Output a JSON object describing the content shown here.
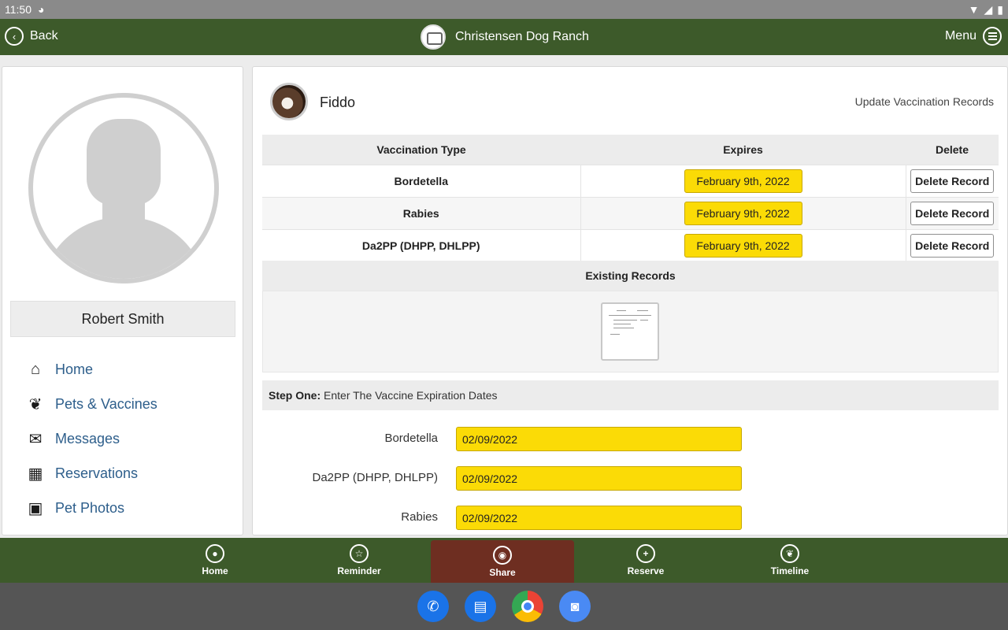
{
  "status_bar": {
    "time": "11:50"
  },
  "header": {
    "back_label": "Back",
    "title": "Christensen Dog Ranch",
    "menu_label": "Menu"
  },
  "sidebar": {
    "user_name": "Robert Smith",
    "items": [
      {
        "label": "Home",
        "icon": "home-icon"
      },
      {
        "label": "Pets & Vaccines",
        "icon": "paw-icon"
      },
      {
        "label": "Messages",
        "icon": "envelope-icon"
      },
      {
        "label": "Reservations",
        "icon": "calendar-icon"
      },
      {
        "label": "Pet Photos",
        "icon": "photos-icon"
      }
    ]
  },
  "pet": {
    "name": "Fiddo",
    "update_link": "Update Vaccination Records"
  },
  "vaccinations": {
    "columns": [
      "Vaccination Type",
      "Expires",
      "Delete"
    ],
    "rows": [
      {
        "type": "Bordetella",
        "expires": "February 9th, 2022",
        "delete_label": "Delete Record"
      },
      {
        "type": "Rabies",
        "expires": "February 9th, 2022",
        "delete_label": "Delete Record"
      },
      {
        "type": "Da2PP (DHPP, DHLPP)",
        "expires": "February 9th, 2022",
        "delete_label": "Delete Record"
      }
    ]
  },
  "existing_records": {
    "title": "Existing Records"
  },
  "step_one": {
    "prefix": "Step One:",
    "text": " Enter The Vaccine Expiration Dates"
  },
  "form": {
    "fields": [
      {
        "label": "Bordetella",
        "value": "02/09/2022"
      },
      {
        "label": "Da2PP (DHPP, DHLPP)",
        "value": "02/09/2022"
      },
      {
        "label": "Rabies",
        "value": "02/09/2022"
      }
    ]
  },
  "bottom_nav": {
    "items": [
      {
        "label": "Home",
        "icon": "person-icon"
      },
      {
        "label": "Reminder",
        "icon": "star-icon"
      },
      {
        "label": "Share",
        "icon": "camera-icon"
      },
      {
        "label": "Reserve",
        "icon": "plus-icon"
      },
      {
        "label": "Timeline",
        "icon": "paw-icon"
      }
    ]
  },
  "colors": {
    "header_green": "#3d5a2a",
    "share_active": "#6e2e21",
    "date_yellow": "#fbdb06",
    "nav_link_blue": "#2d5e8b"
  }
}
